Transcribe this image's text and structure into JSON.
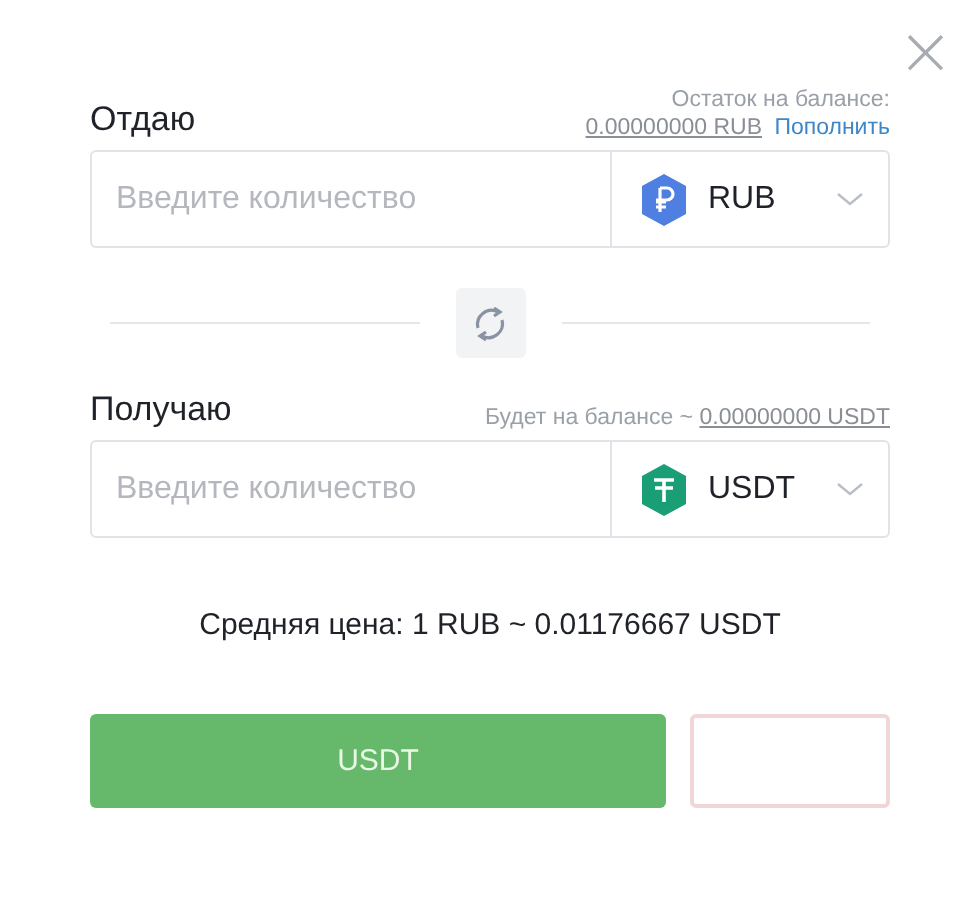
{
  "close": {
    "label": "×"
  },
  "give": {
    "label": "Отдаю",
    "balance_caption": "Остаток на балансе:",
    "balance_value": "0.00000000 RUB",
    "topup_link": "Пополнить",
    "amount": {
      "placeholder": "Введите количество"
    },
    "currency": {
      "code": "RUB",
      "kind": "rub"
    }
  },
  "receive": {
    "label": "Получаю",
    "balance_caption": "Будет на балансе ~",
    "balance_value": "0.00000000 USDT",
    "amount": {
      "placeholder": "Введите количество"
    },
    "currency": {
      "code": "USDT",
      "kind": "usdt"
    }
  },
  "average_price": "Средняя цена: 1 RUB ~ 0.01176667 USDT",
  "buttons": [
    {
      "label": "USDT",
      "kind": "primary"
    },
    {
      "kind": "outline"
    }
  ]
}
